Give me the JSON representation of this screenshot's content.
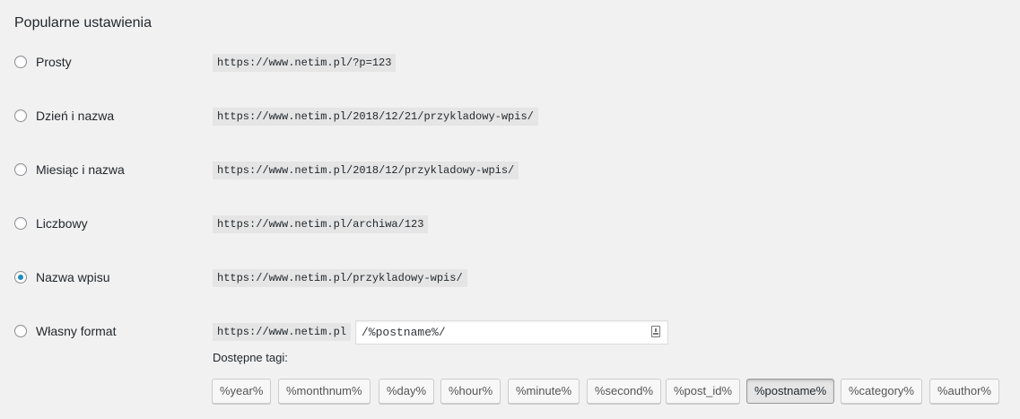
{
  "section": {
    "title": "Popularne ustawienia"
  },
  "options": [
    {
      "label": "Prosty",
      "example": "https://www.netim.pl/?p=123",
      "checked": false
    },
    {
      "label": "Dzień i nazwa",
      "example": "https://www.netim.pl/2018/12/21/przykladowy-wpis/",
      "checked": false
    },
    {
      "label": "Miesiąc i nazwa",
      "example": "https://www.netim.pl/2018/12/przykladowy-wpis/",
      "checked": false
    },
    {
      "label": "Liczbowy",
      "example": "https://www.netim.pl/archiwa/123",
      "checked": false
    },
    {
      "label": "Nazwa wpisu",
      "example": "https://www.netim.pl/przykladowy-wpis/",
      "checked": true
    }
  ],
  "custom": {
    "label": "Własny format",
    "prefix": "https://www.netim.pl",
    "value": "/%postname%/",
    "checked": false
  },
  "tags": {
    "label": "Dostępne tagi:",
    "items": [
      {
        "label": "%year%"
      },
      {
        "label": "%monthnum%"
      },
      {
        "label": "%day%"
      },
      {
        "label": "%hour%"
      },
      {
        "label": "%minute%"
      },
      {
        "label": "%second%"
      },
      {
        "label": "%post_id%"
      },
      {
        "label": "%postname%",
        "active": true
      },
      {
        "label": "%category%"
      },
      {
        "label": "%author%"
      }
    ]
  },
  "colors": {
    "accent": "#1e8cbe",
    "background": "#f1f1f1",
    "code_bg": "#e5e5e5"
  },
  "icons": {
    "input_icon": "document-lock-icon"
  }
}
